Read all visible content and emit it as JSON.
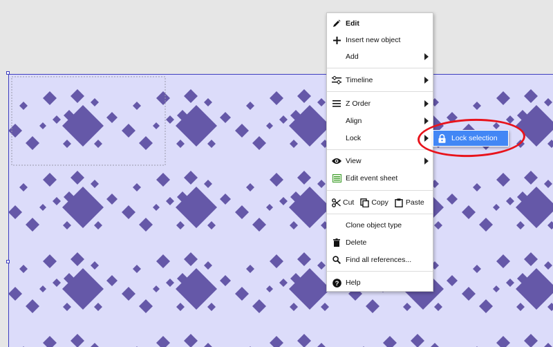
{
  "colors": {
    "canvas_bg": "#e6e6e6",
    "object_fill": "#dcdcfa",
    "diamond": "#6558a8",
    "selection_border": "#3c3cbe",
    "submenu_selected": "#4287f5",
    "annotation_ring": "#e8141c"
  },
  "context_menu": {
    "items": [
      {
        "label": "Edit",
        "icon": "pencil-icon"
      },
      {
        "label": "Insert new object",
        "icon": "plus-icon"
      },
      {
        "label": "Add",
        "icon": "",
        "submenu": true
      },
      {
        "label": "Timeline",
        "icon": "timeline-icon",
        "submenu": true
      },
      {
        "label": "Z Order",
        "icon": "z-order-icon",
        "submenu": true
      },
      {
        "label": "Align",
        "icon": "",
        "submenu": true
      },
      {
        "label": "Lock",
        "icon": "",
        "submenu": true
      },
      {
        "label": "View",
        "icon": "eye-icon",
        "submenu": true
      },
      {
        "label": "Edit event sheet",
        "icon": "event-sheet-icon"
      },
      {
        "label": "Clone object type",
        "icon": ""
      },
      {
        "label": "Delete",
        "icon": "trash-icon"
      },
      {
        "label": "Find all references...",
        "icon": "search-icon"
      },
      {
        "label": "Help",
        "icon": "help-icon"
      }
    ],
    "clipboard": {
      "cut": "Cut",
      "copy": "Copy",
      "paste": "Paste"
    }
  },
  "lock_submenu": {
    "items": [
      {
        "label": "Lock selection",
        "icon": "lock-icon",
        "selected": true
      }
    ]
  }
}
